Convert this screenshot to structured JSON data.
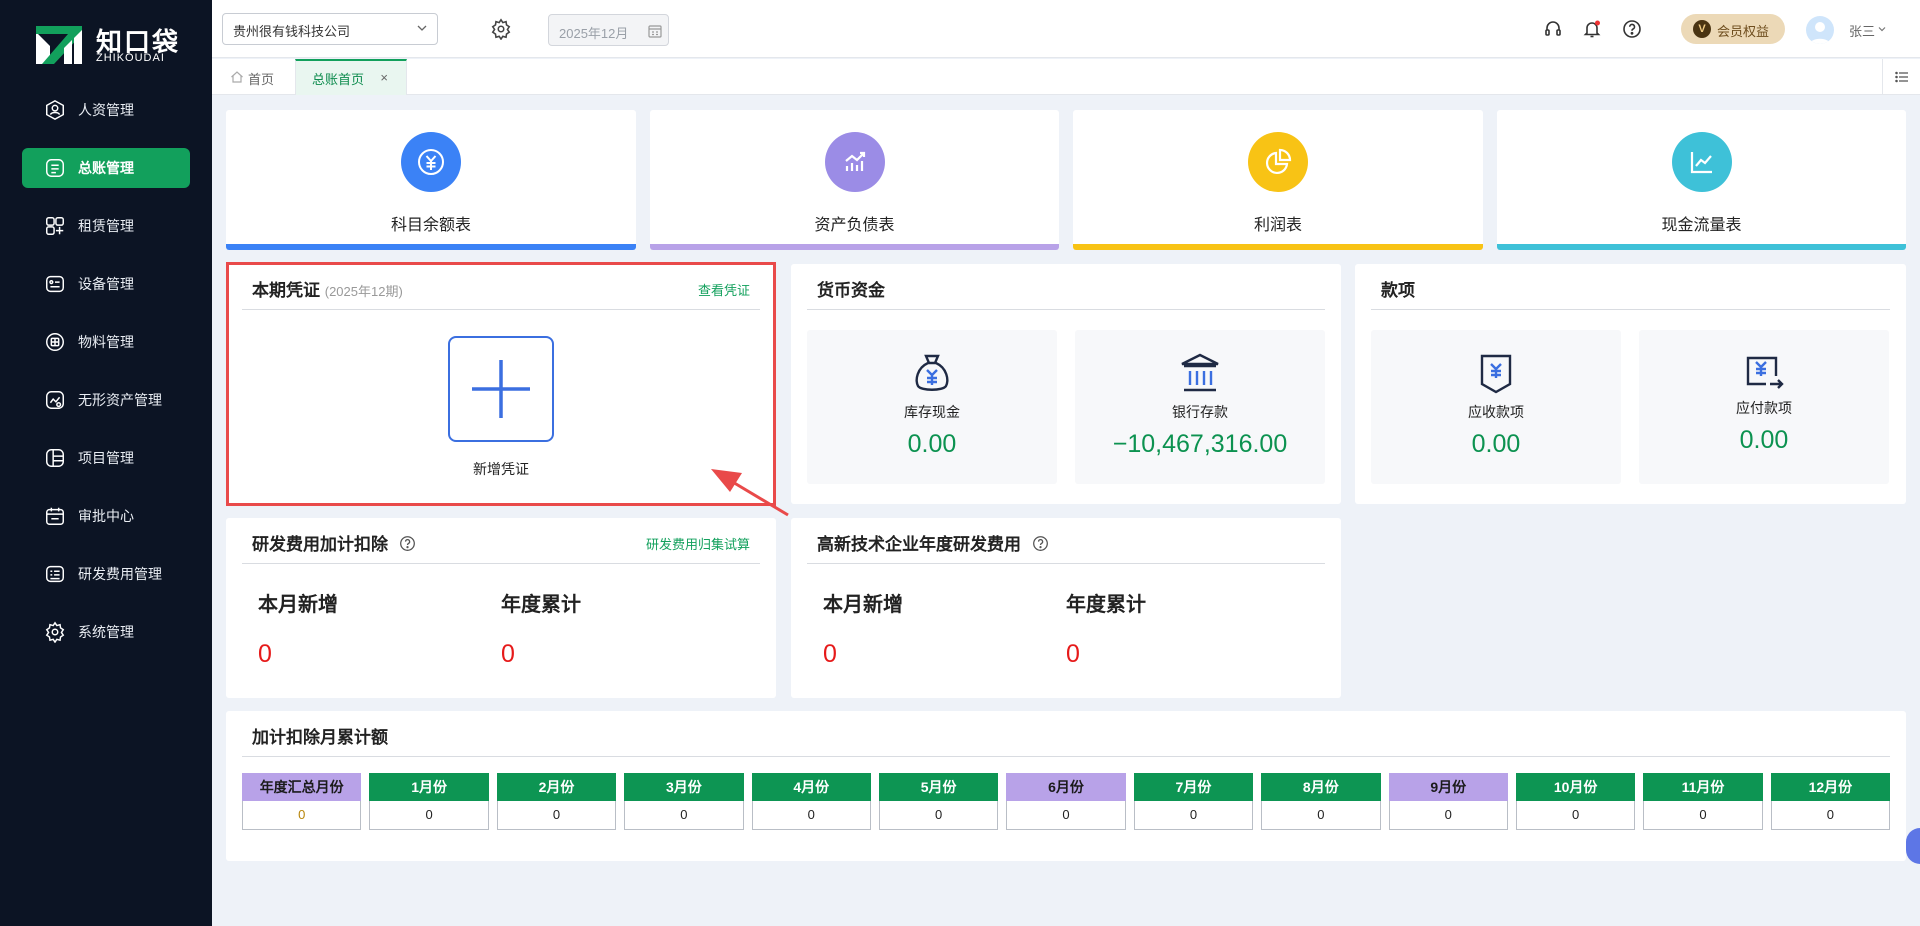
{
  "app": {
    "brand_cn": "知口袋",
    "brand_en": "ZHIKOUDAI"
  },
  "sidebar": {
    "items": [
      {
        "label": "人资管理",
        "icon": "user-icon",
        "active": false
      },
      {
        "label": "总账管理",
        "icon": "ledger-icon",
        "active": true
      },
      {
        "label": "租赁管理",
        "icon": "lease-icon",
        "active": false
      },
      {
        "label": "设备管理",
        "icon": "device-icon",
        "active": false
      },
      {
        "label": "物料管理",
        "icon": "box-icon",
        "active": false
      },
      {
        "label": "无形资产管理",
        "icon": "asset-icon",
        "active": false
      },
      {
        "label": "项目管理",
        "icon": "project-icon",
        "active": false
      },
      {
        "label": "审批中心",
        "icon": "calendar-icon",
        "active": false
      },
      {
        "label": "研发费用管理",
        "icon": "rd-icon",
        "active": false
      },
      {
        "label": "系统管理",
        "icon": "gear-icon",
        "active": false
      }
    ]
  },
  "header": {
    "company": "贵州很有钱科技公司",
    "period": "2025年12月",
    "vip_badge": "V",
    "vip_label": "会员权益",
    "user_name": "张三"
  },
  "tabs": {
    "home": "首页",
    "active": "总账首页",
    "close": "×"
  },
  "reports": [
    {
      "label": "科目余额表",
      "icon": "yuan-circle-icon",
      "color": "#3b82f6"
    },
    {
      "label": "资产负债表",
      "icon": "bar-growth-icon",
      "color": "#9b8ce6"
    },
    {
      "label": "利润表",
      "icon": "pie-chart-icon",
      "color": "#f8c315"
    },
    {
      "label": "现金流量表",
      "icon": "line-trend-icon",
      "color": "#3ec1d8"
    }
  ],
  "voucher": {
    "title": "本期凭证",
    "period": "(2025年12期)",
    "link": "查看凭证",
    "add_label": "新增凭证"
  },
  "cash": {
    "title": "货币资金",
    "items": [
      {
        "label": "库存现金",
        "value": "0.00",
        "icon": "money-bag-icon"
      },
      {
        "label": "银行存款",
        "value": "−10,467,316.00",
        "icon": "bank-icon"
      }
    ]
  },
  "payments": {
    "title": "款项",
    "items": [
      {
        "label": "应收款项",
        "value": "0.00",
        "icon": "receivable-icon"
      },
      {
        "label": "应付款项",
        "value": "0.00",
        "icon": "payable-icon"
      }
    ]
  },
  "rd_deduct": {
    "title": "研发费用加计扣除",
    "link": "研发费用归集试算",
    "month_label": "本月新增",
    "month_value": "0",
    "year_label": "年度累计",
    "year_value": "0"
  },
  "hitech": {
    "title": "高新技术企业年度研发费用",
    "month_label": "本月新增",
    "month_value": "0",
    "year_label": "年度累计",
    "year_value": "0"
  },
  "monthly": {
    "title": "加计扣除月累计额",
    "green": "#0d9553",
    "purple": "#b8a2e8",
    "columns": [
      {
        "label": "年度汇总月份",
        "value": "0",
        "style": "purple"
      },
      {
        "label": "1月份",
        "value": "0",
        "style": "green"
      },
      {
        "label": "2月份",
        "value": "0",
        "style": "green"
      },
      {
        "label": "3月份",
        "value": "0",
        "style": "green"
      },
      {
        "label": "4月份",
        "value": "0",
        "style": "green"
      },
      {
        "label": "5月份",
        "value": "0",
        "style": "green"
      },
      {
        "label": "6月份",
        "value": "0",
        "style": "purple"
      },
      {
        "label": "7月份",
        "value": "0",
        "style": "green"
      },
      {
        "label": "8月份",
        "value": "0",
        "style": "green"
      },
      {
        "label": "9月份",
        "value": "0",
        "style": "purple"
      },
      {
        "label": "10月份",
        "value": "0",
        "style": "green"
      },
      {
        "label": "11月份",
        "value": "0",
        "style": "green"
      },
      {
        "label": "12月份",
        "value": "0",
        "style": "green"
      }
    ]
  },
  "colors": {
    "accent": "#12a05c",
    "highlight": "#e94a4a",
    "negative_value": "#e61a1a"
  }
}
